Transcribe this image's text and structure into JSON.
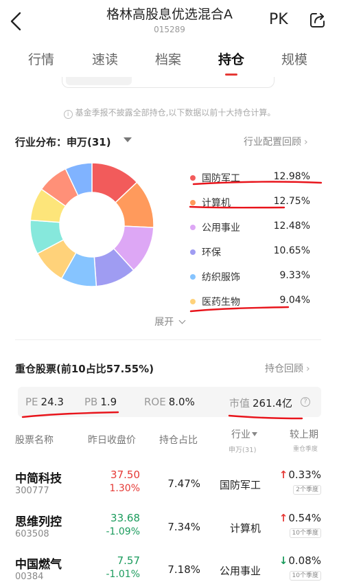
{
  "header": {
    "title": "格林高股息优选混合A",
    "code": "015289",
    "pk_label": "PK"
  },
  "tabs": [
    {
      "label": "行情",
      "active": false
    },
    {
      "label": "速读",
      "active": false
    },
    {
      "label": "档案",
      "active": false
    },
    {
      "label": "持仓",
      "active": true
    },
    {
      "label": "规模",
      "active": false
    }
  ],
  "notice": "基金季报不披露全部持仓,以下数据以前十大持仓计算。",
  "industry": {
    "title": "行业分布：申万(31)",
    "link": "行业配置回顾",
    "expand_label": "展开",
    "items": [
      {
        "name": "国防军工",
        "pct": "12.98%",
        "color": "#f25b5b"
      },
      {
        "name": "计算机",
        "pct": "12.75%",
        "color": "#ff9a5c"
      },
      {
        "name": "公用事业",
        "pct": "12.48%",
        "color": "#dda7f5"
      },
      {
        "name": "环保",
        "pct": "10.65%",
        "color": "#9f9cf2"
      },
      {
        "name": "纺织服饰",
        "pct": "9.33%",
        "color": "#86c4ff"
      },
      {
        "name": "医药生物",
        "pct": "9.04%",
        "color": "#ffd27a"
      }
    ]
  },
  "chart_data": {
    "type": "pie",
    "title": "",
    "labels": [
      "国防军工",
      "计算机",
      "公用事业",
      "环保",
      "纺织服饰",
      "医药生物",
      "",
      "",
      "",
      ""
    ],
    "values": [
      12.98,
      12.75,
      12.48,
      10.65,
      9.33,
      9.04,
      8.9,
      8.6,
      8.2,
      7.05
    ],
    "colors": [
      "#f25b5b",
      "#ff9a5c",
      "#dda7f5",
      "#9f9cf2",
      "#86c4ff",
      "#ffd27a",
      "#86e8dc",
      "#fde57a",
      "#ff9078",
      "#80b3ff"
    ]
  },
  "holdings": {
    "title": "重仓股票(前10占比57.55%)",
    "link": "持仓回顾",
    "metrics": {
      "pe_label": "PE",
      "pe": "24.3",
      "pb_label": "PB",
      "pb": "1.9",
      "roe_label": "ROE",
      "roe": "8.0%",
      "mv_label": "市值",
      "mv": "261.4亿"
    },
    "columns": {
      "name": "股票名称",
      "price": "昨日收盘价",
      "weight": "持仓占比",
      "industry": "行业",
      "industry_sub": "申万(31)",
      "change": "较上期",
      "change_sub": "重仓季度"
    },
    "rows": [
      {
        "name": "中简科技",
        "code": "300777",
        "price": "37.50",
        "chg": "1.30%",
        "dir": "up",
        "weight": "7.47%",
        "industry": "国防军工",
        "qchg": "0.33%",
        "qdir": "up",
        "quarters": "2个季度"
      },
      {
        "name": "思维列控",
        "code": "603508",
        "price": "33.68",
        "chg": "-1.09%",
        "dir": "down",
        "weight": "7.34%",
        "industry": "计算机",
        "qchg": "0.54%",
        "qdir": "up",
        "quarters": "10个季度"
      },
      {
        "name": "中国燃气",
        "code": "00384",
        "price": "7.57",
        "chg": "-1.01%",
        "dir": "down",
        "weight": "7.18%",
        "industry": "公用事业",
        "qchg": "0.08%",
        "qdir": "down",
        "quarters": "10个季度"
      }
    ]
  }
}
